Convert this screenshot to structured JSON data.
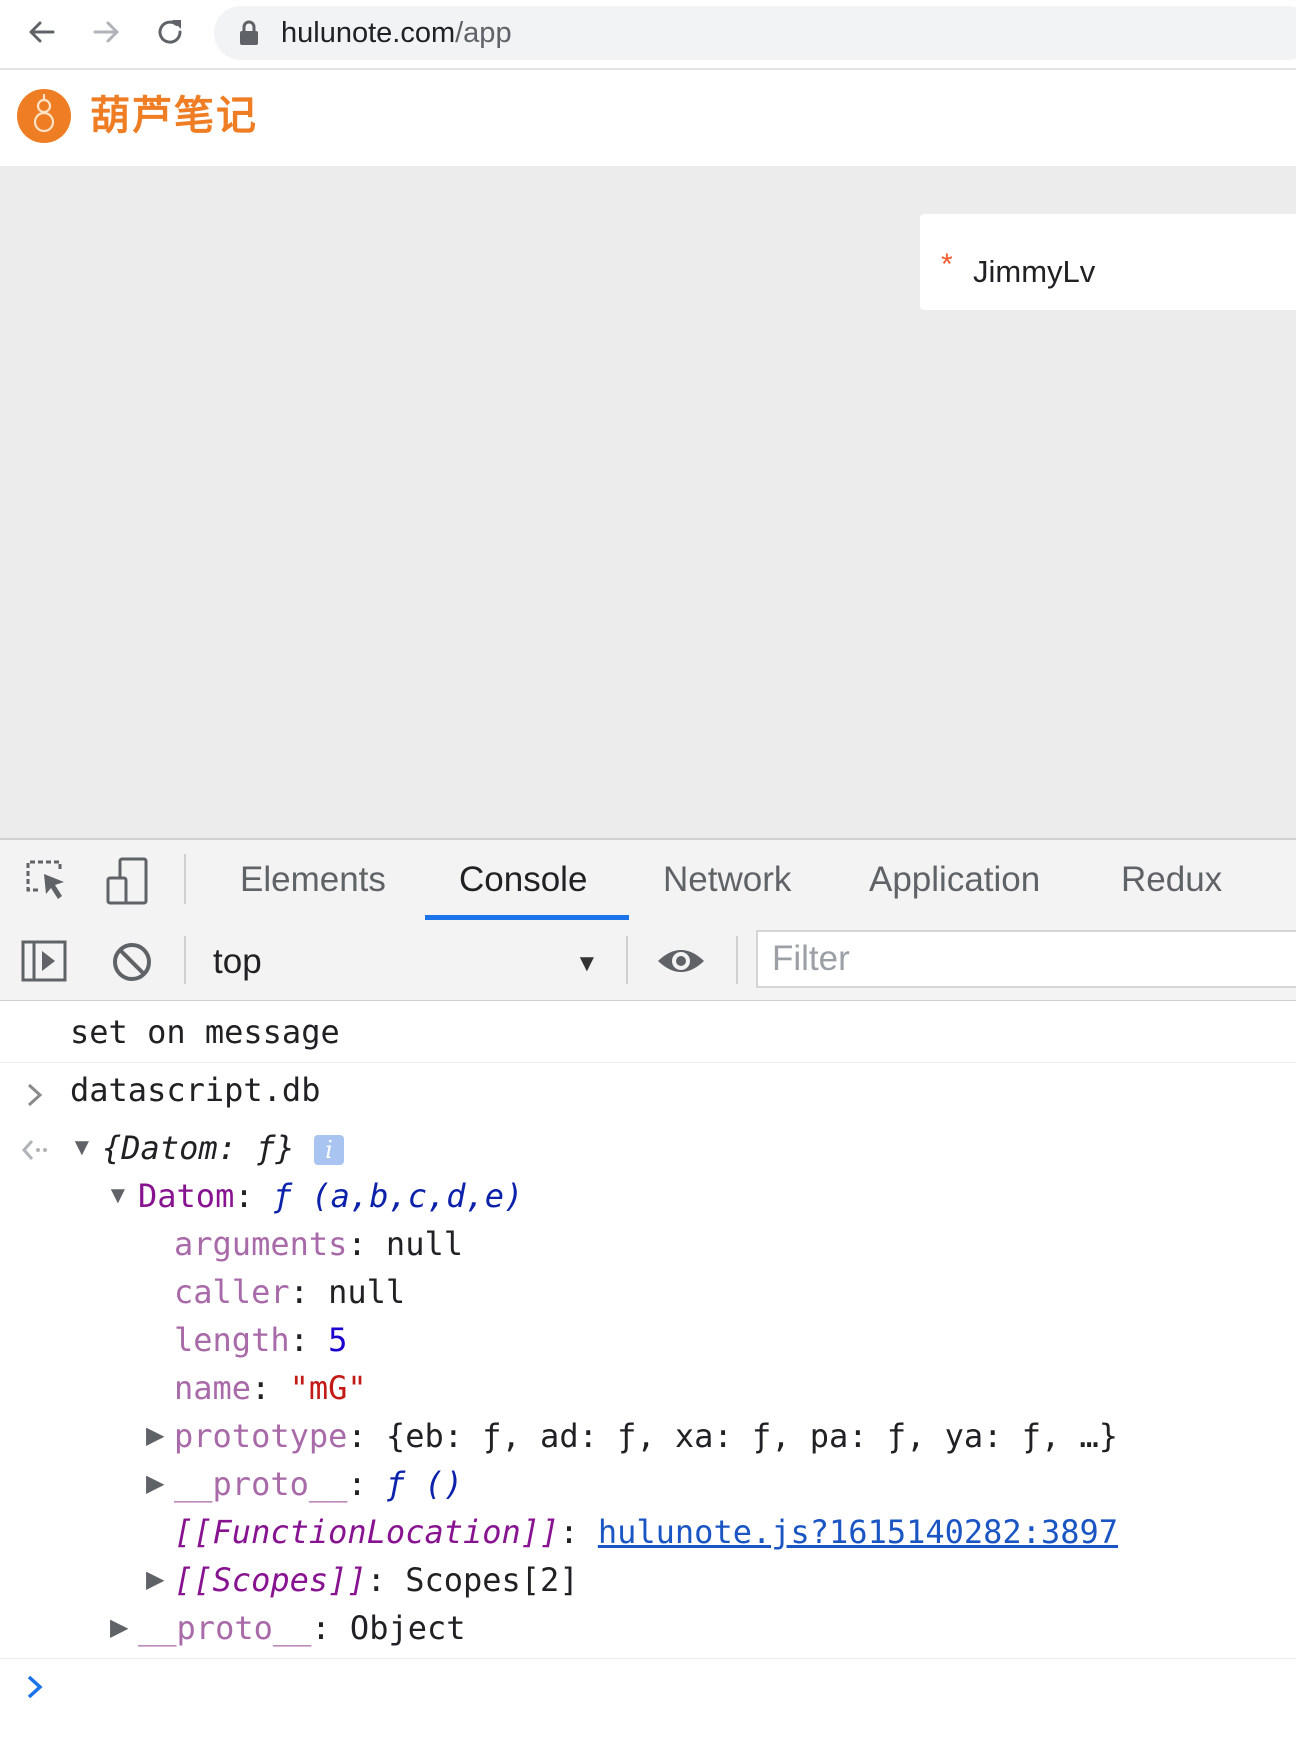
{
  "browser": {
    "url_host": "hulunote.com",
    "url_path": "/app",
    "icons": [
      "back-icon",
      "forward-icon",
      "reload-icon",
      "lock-icon"
    ]
  },
  "app": {
    "name": "葫芦笔记",
    "brand_color": "#ef7d24"
  },
  "user": {
    "marker": "*",
    "name": "JimmyLv"
  },
  "devtools": {
    "tabs": [
      {
        "label": "Elements"
      },
      {
        "label": "Console"
      },
      {
        "label": "Network"
      },
      {
        "label": "Application"
      },
      {
        "label": "Redux"
      }
    ],
    "active_tab": "Console",
    "accent_color": "#1a73e8",
    "context": "top",
    "filter_placeholder": "Filter"
  },
  "console": {
    "log_message": "set on message",
    "command": "datascript.db",
    "result": {
      "summary": "{Datom: ƒ}",
      "datom_key": "Datom",
      "datom_val": "ƒ (a,b,c,d,e)",
      "props": [
        {
          "key": "arguments",
          "value": "null"
        },
        {
          "key": "caller",
          "value": "null"
        },
        {
          "key": "length",
          "value": "5"
        },
        {
          "key": "name",
          "value": "\"mG\""
        }
      ],
      "prototype_key": "prototype",
      "prototype_val": "{eb: ƒ, ad: ƒ, xa: ƒ, pa: ƒ, ya: ƒ, …}",
      "inner_proto_key": "__proto__",
      "inner_proto_val": "ƒ ()",
      "function_location_key": "[[FunctionLocation]]",
      "function_location_val": "hulunote.js?1615140282:3897",
      "scopes_key": "[[Scopes]]",
      "scopes_val": "Scopes[2]",
      "outer_proto_key": "__proto__",
      "outer_proto_val": "Object"
    }
  }
}
